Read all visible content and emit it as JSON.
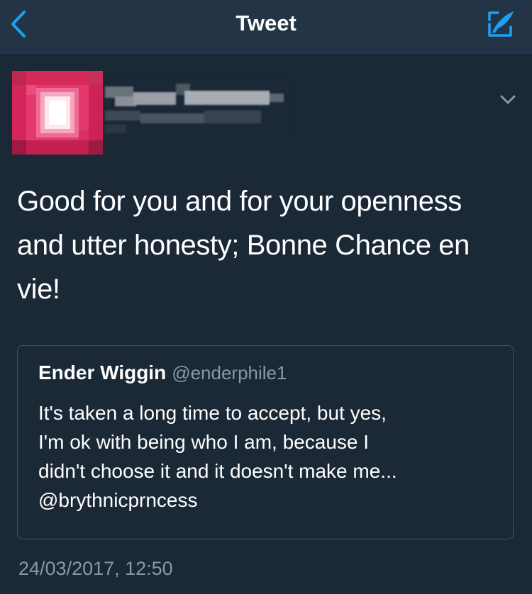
{
  "nav": {
    "title": "Tweet",
    "back_icon": "chevron-left-icon",
    "compose_icon": "compose-tweet-icon",
    "accent_color": "#1da1f2"
  },
  "tweet": {
    "author_icon": "avatar-pixelated",
    "menu_icon": "chevron-down-icon",
    "text": "Good for you and for your openness and utter honesty; Bonne Chance en vie!",
    "timestamp": "24/03/2017, 12:50"
  },
  "quoted_tweet": {
    "name": "Ender Wiggin",
    "handle": "@enderphile1",
    "lines": [
      "It's taken a long time to accept, but yes,",
      "I'm ok with being who I am, because I",
      "didn't choose it and it doesn't make me...",
      "@brythnicprncess"
    ]
  },
  "colors": {
    "background": "#1b2836",
    "nav_background": "#243447",
    "secondary_text": "#8899a6",
    "quote_border": "#3d5466"
  }
}
